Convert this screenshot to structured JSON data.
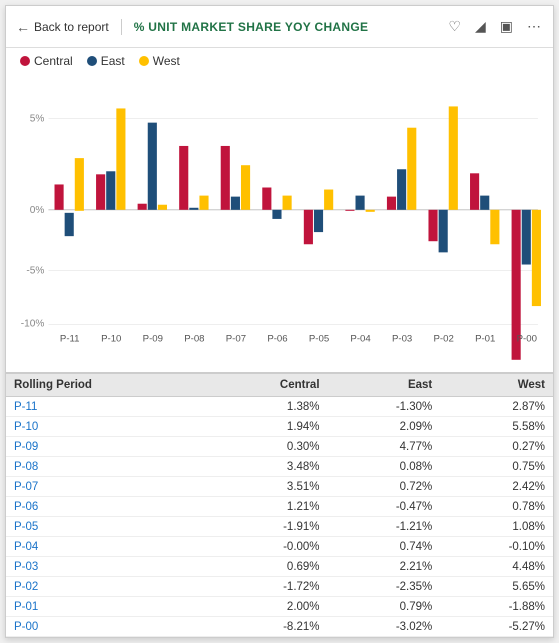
{
  "header": {
    "back_label": "Back to report",
    "chart_title": "% UNIT MARKET SHARE YOY CHANGE",
    "icons": [
      "bookmark-icon",
      "filter-icon",
      "expand-icon",
      "more-icon"
    ]
  },
  "legend": [
    {
      "label": "Central",
      "color": "#C0143C"
    },
    {
      "label": "East",
      "color": "#1F4E79"
    },
    {
      "label": "West",
      "color": "#FFC000"
    }
  ],
  "chart": {
    "y_labels": [
      "5%",
      "0%",
      "-5%",
      "-10%"
    ],
    "x_labels": [
      "P-11",
      "P-10",
      "P-09",
      "P-08",
      "P-07",
      "P-06",
      "P-05",
      "P-04",
      "P-03",
      "P-02",
      "P-01",
      "P-00"
    ],
    "data": [
      {
        "period": "P-11",
        "central": 1.38,
        "east": -1.3,
        "west": 2.87
      },
      {
        "period": "P-10",
        "central": 1.94,
        "east": 2.09,
        "west": 5.58
      },
      {
        "period": "P-09",
        "central": 0.3,
        "east": 4.77,
        "west": 0.27
      },
      {
        "period": "P-08",
        "central": 3.48,
        "east": 0.08,
        "west": 0.75
      },
      {
        "period": "P-07",
        "central": 3.51,
        "east": 0.72,
        "west": 2.42
      },
      {
        "period": "P-06",
        "central": 1.21,
        "east": -0.47,
        "west": 0.78
      },
      {
        "period": "P-05",
        "central": -1.91,
        "east": -1.21,
        "west": 1.08
      },
      {
        "period": "P-04",
        "central": -0.0,
        "east": 0.74,
        "west": -0.1
      },
      {
        "period": "P-03",
        "central": 0.69,
        "east": 2.21,
        "west": 4.48
      },
      {
        "period": "P-02",
        "central": -1.72,
        "east": -2.35,
        "west": 5.65
      },
      {
        "period": "P-01",
        "central": 2.0,
        "east": 0.79,
        "west": -1.88
      },
      {
        "period": "P-00",
        "central": -8.21,
        "east": -3.02,
        "west": -5.27
      }
    ]
  },
  "table": {
    "headers": [
      "Rolling Period",
      "Central",
      "East",
      "West"
    ],
    "rows": [
      {
        "period": "P-11",
        "central": "1.38%",
        "east": "-1.30%",
        "west": "2.87%"
      },
      {
        "period": "P-10",
        "central": "1.94%",
        "east": "2.09%",
        "west": "5.58%"
      },
      {
        "period": "P-09",
        "central": "0.30%",
        "east": "4.77%",
        "west": "0.27%"
      },
      {
        "period": "P-08",
        "central": "3.48%",
        "east": "0.08%",
        "west": "0.75%"
      },
      {
        "period": "P-07",
        "central": "3.51%",
        "east": "0.72%",
        "west": "2.42%"
      },
      {
        "period": "P-06",
        "central": "1.21%",
        "east": "-0.47%",
        "west": "0.78%"
      },
      {
        "period": "P-05",
        "central": "-1.91%",
        "east": "-1.21%",
        "west": "1.08%"
      },
      {
        "period": "P-04",
        "central": "-0.00%",
        "east": "0.74%",
        "west": "-0.10%"
      },
      {
        "period": "P-03",
        "central": "0.69%",
        "east": "2.21%",
        "west": "4.48%"
      },
      {
        "period": "P-02",
        "central": "-1.72%",
        "east": "-2.35%",
        "west": "5.65%"
      },
      {
        "period": "P-01",
        "central": "2.00%",
        "east": "0.79%",
        "west": "-1.88%"
      },
      {
        "period": "P-00",
        "central": "-8.21%",
        "east": "-3.02%",
        "west": "-5.27%"
      }
    ]
  }
}
